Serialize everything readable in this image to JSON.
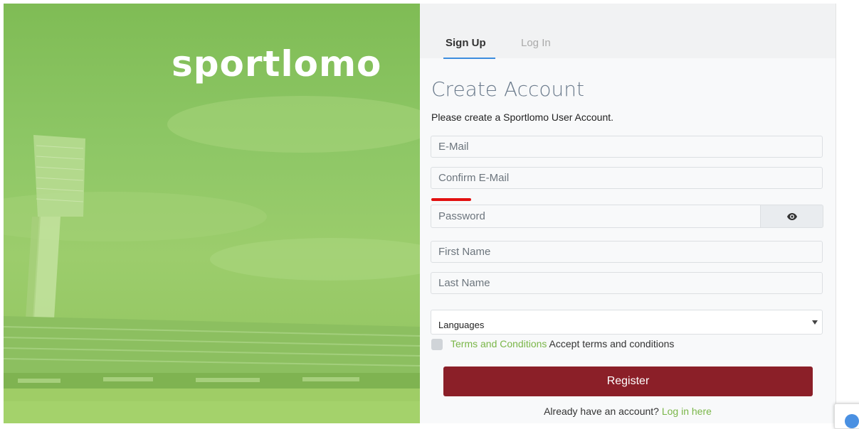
{
  "brand": {
    "logo_text": "sportlomo"
  },
  "tabs": [
    {
      "label": "Sign Up",
      "active": true
    },
    {
      "label": "Log In",
      "active": false
    }
  ],
  "form": {
    "title": "Create Account",
    "subtitle": "Please create a Sportlomo User Account.",
    "email_placeholder": "E-Mail",
    "confirm_email_placeholder": "Confirm E-Mail",
    "password_placeholder": "Password",
    "password_toggle_icon": "eye-icon",
    "first_name_placeholder": "First Name",
    "last_name_placeholder": "Last Name",
    "languages_selected": "Languages",
    "terms_link": "Terms and Conditions",
    "terms_text": "Accept terms and conditions",
    "register_label": "Register",
    "already_text": "Already have an account?",
    "login_link": "Log in here"
  },
  "colors": {
    "accent": "#8b1f28",
    "link": "#7ab648",
    "tab_underline": "#3c8dde",
    "warning_bar": "#e21010"
  }
}
